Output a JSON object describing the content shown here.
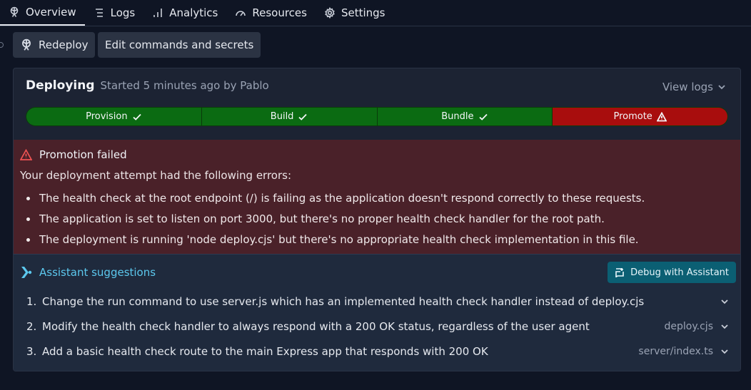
{
  "tabs": [
    {
      "label": "Overview",
      "icon": "deploy-icon",
      "active": true
    },
    {
      "label": "Logs",
      "icon": "list-icon"
    },
    {
      "label": "Analytics",
      "icon": "bar-chart-icon"
    },
    {
      "label": "Resources",
      "icon": "gauge-icon"
    },
    {
      "label": "Settings",
      "icon": "gear-icon"
    }
  ],
  "actions": {
    "redeploy_label": "Redeploy",
    "edit_label": "Edit commands and secrets"
  },
  "deployment": {
    "status": "Deploying",
    "subtitle": "Started 5 minutes ago by Pablo",
    "view_logs": "View logs",
    "steps": [
      {
        "label": "Provision",
        "state": "success"
      },
      {
        "label": "Build",
        "state": "success"
      },
      {
        "label": "Bundle",
        "state": "success"
      },
      {
        "label": "Promote",
        "state": "failed"
      }
    ]
  },
  "error": {
    "title": "Promotion failed",
    "intro": "Your deployment attempt had the following errors:",
    "items": [
      "The health check at the root endpoint (/) is failing as the application doesn't respond correctly to these requests.",
      "The application is set to listen on port 3000, but there's no proper health check handler for the root path.",
      "The deployment is running 'node deploy.cjs' but there's no appropriate health check implementation in this file."
    ]
  },
  "suggestions": {
    "title": "Assistant suggestions",
    "debug_label": "Debug with Assistant",
    "items": [
      {
        "num": "1.",
        "text": "Change the run command to use server.js which has an implemented health check handler instead of deploy.cjs",
        "file": ""
      },
      {
        "num": "2.",
        "text": "Modify the health check handler to always respond with a 200 OK status, regardless of the user agent",
        "file": "deploy.cjs"
      },
      {
        "num": "3.",
        "text": "Add a basic health check route to the main Express app that responds with 200 OK",
        "file": "server/index.ts"
      }
    ]
  },
  "colors": {
    "success": "#0b6b12",
    "failed": "#a80d0d",
    "error_bg": "#4a2129",
    "accent": "#5cc8ee"
  }
}
